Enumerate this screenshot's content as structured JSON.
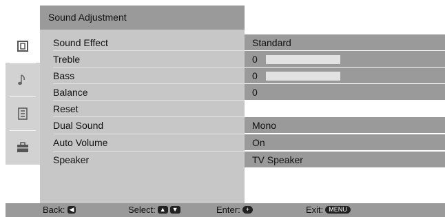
{
  "header": {
    "title": "Sound Adjustment"
  },
  "sidebar": {
    "items": [
      {
        "icon": "picture-icon",
        "active": true
      },
      {
        "icon": "music-note-icon",
        "active": false
      },
      {
        "icon": "features-icon",
        "active": false
      },
      {
        "icon": "setup-toolbox-icon",
        "active": false
      }
    ]
  },
  "rows": [
    {
      "label": "Sound Effect",
      "value": "Standard"
    },
    {
      "label": "Treble",
      "value": "0",
      "level": 0.5
    },
    {
      "label": "Bass",
      "value": "0",
      "level": 0.5
    },
    {
      "label": "Balance",
      "value": "0"
    },
    {
      "label": "Reset",
      "value": ""
    },
    {
      "label": "Dual Sound",
      "value": "Mono"
    },
    {
      "label": "Auto Volume",
      "value": "On"
    },
    {
      "label": "Speaker",
      "value": "TV Speaker"
    }
  ],
  "footer": {
    "back": "Back:",
    "select": "Select:",
    "enter": "Enter:",
    "exit": "Exit:",
    "menu_key": "MENU"
  }
}
